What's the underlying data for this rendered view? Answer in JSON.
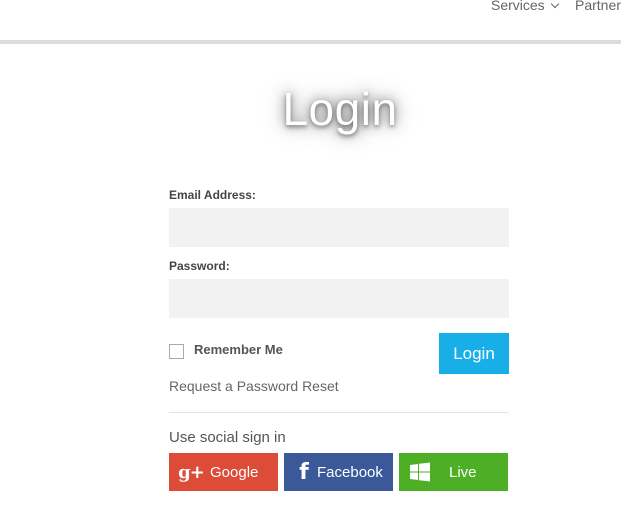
{
  "nav": {
    "services_label": "Services",
    "partners_label": "Partner"
  },
  "login": {
    "title": "Login",
    "email_label": "Email Address:",
    "email_value": "",
    "password_label": "Password:",
    "password_value": "",
    "remember_label": "Remember Me",
    "remember_checked": false,
    "submit_label": "Login",
    "reset_link": "Request a Password Reset"
  },
  "social": {
    "heading": "Use social sign in",
    "buttons": [
      {
        "label": "Google",
        "icon": "google-plus-icon",
        "color": "#dd4b39"
      },
      {
        "label": "Facebook",
        "icon": "facebook-icon",
        "color": "#3b5998"
      },
      {
        "label": "Live",
        "icon": "windows-icon",
        "color": "#4caf24"
      }
    ]
  },
  "colors": {
    "accent": "#18aee8",
    "input_bg": "#f2f2f2"
  }
}
